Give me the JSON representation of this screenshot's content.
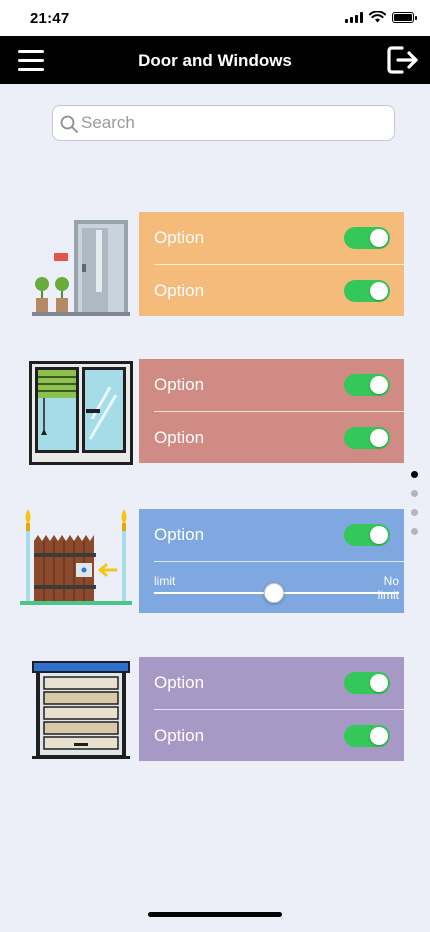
{
  "status_bar": {
    "time": "21:47"
  },
  "header": {
    "title": "Door and Windows",
    "menu_icon": "hamburger-menu-icon",
    "logout_icon": "logout-icon"
  },
  "search": {
    "placeholder": "Search",
    "value": ""
  },
  "categories": [
    {
      "image": "door-illustration",
      "color": "#f5bb7a",
      "rows": [
        {
          "label": "Option",
          "on": true
        },
        {
          "label": "Option",
          "on": true
        }
      ]
    },
    {
      "image": "window-illustration",
      "color": "#d08b85",
      "rows": [
        {
          "label": "Option",
          "on": true
        },
        {
          "label": "Option",
          "on": true
        }
      ]
    },
    {
      "image": "gate-illustration",
      "color": "#7fa8e0",
      "rows": [
        {
          "label": "Option",
          "on": true
        }
      ],
      "slider": {
        "min_label": "limit",
        "max_label": "No limit",
        "value": 0.49
      }
    },
    {
      "image": "garage-door-illustration",
      "color": "#a699c5",
      "rows": [
        {
          "label": "Option",
          "on": true
        },
        {
          "label": "Option",
          "on": true
        }
      ]
    }
  ],
  "pagination": {
    "count": 4,
    "active": 0
  },
  "colors": {
    "toggle_on": "#34c759",
    "nav_background": "#000000",
    "page_background": "#eceff7"
  }
}
